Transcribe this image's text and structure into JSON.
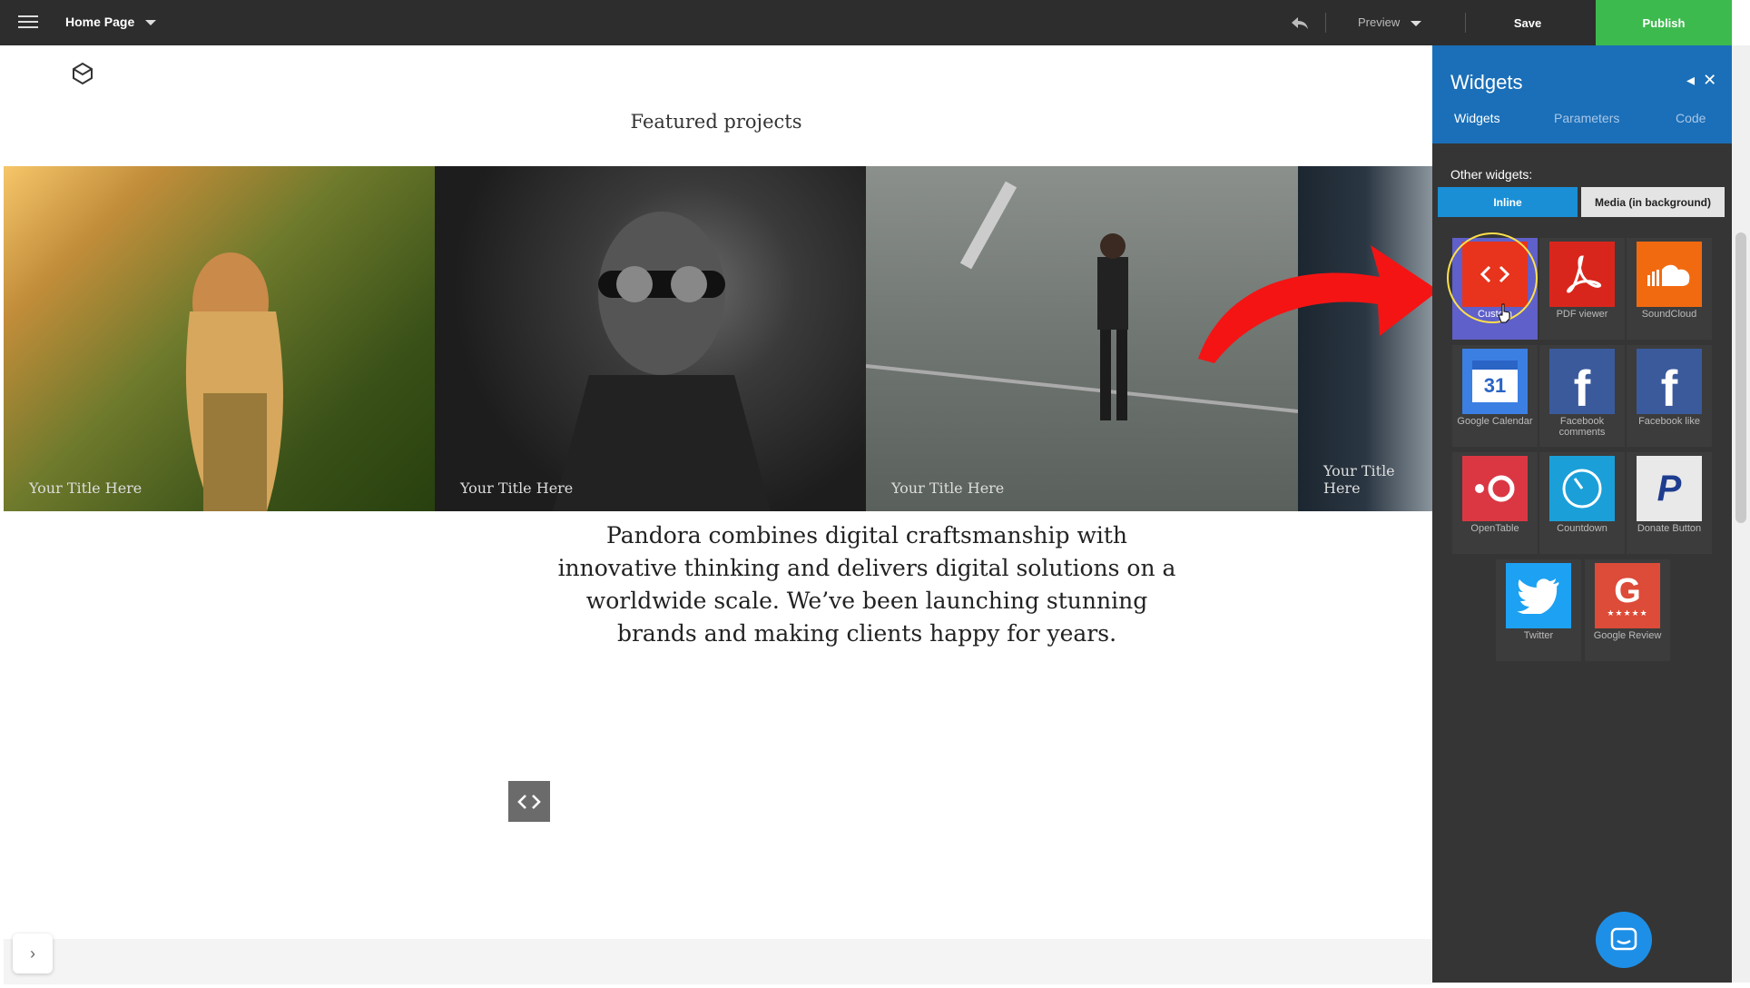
{
  "topbar": {
    "page_label": "Home Page",
    "preview_label": "Preview",
    "save_label": "Save",
    "publish_label": "Publish"
  },
  "canvas": {
    "section_title": "Featured projects",
    "tiles": [
      {
        "title": "Your Title Here"
      },
      {
        "title": "Your Title Here"
      },
      {
        "title": "Your Title Here"
      },
      {
        "title": "Your Title Here"
      }
    ],
    "tagline": "Pandora combines digital craftsmanship with innovative thinking and delivers digital solutions on a worldwide scale. We’ve been launching stunning brands and making clients happy for years."
  },
  "panel": {
    "title": "Widgets",
    "tabs": [
      "Widgets",
      "Parameters",
      "Code"
    ],
    "other_widgets_label": "Other widgets:",
    "mode_inline": "Inline",
    "mode_media": "Media (in background)",
    "widgets": [
      {
        "label": "Custom",
        "color": "#e8341c",
        "icon": "code-icon"
      },
      {
        "label": "PDF viewer",
        "color": "#d9261c",
        "icon": "pdf-icon"
      },
      {
        "label": "SoundCloud",
        "color": "#f26a10",
        "icon": "soundcloud-icon"
      },
      {
        "label": "Google Calendar",
        "color": "#3b7fe3",
        "icon": "calendar-icon"
      },
      {
        "label": "Facebook comments",
        "color": "#3a5a9c",
        "icon": "facebook-icon"
      },
      {
        "label": "Facebook like",
        "color": "#3a5a9c",
        "icon": "facebook-icon"
      },
      {
        "label": "OpenTable",
        "color": "#da3743",
        "icon": "opentable-icon"
      },
      {
        "label": "Countdown",
        "color": "#1a9fd9",
        "icon": "clock-icon"
      },
      {
        "label": "Donate Button",
        "color": "#e9e9e9",
        "icon": "paypal-icon"
      },
      {
        "label": "Twitter",
        "color": "#1da1f2",
        "icon": "twitter-icon"
      },
      {
        "label": "Google Review",
        "color": "#dd4b39",
        "icon": "google-icon"
      }
    ],
    "calendar_day": "31"
  }
}
